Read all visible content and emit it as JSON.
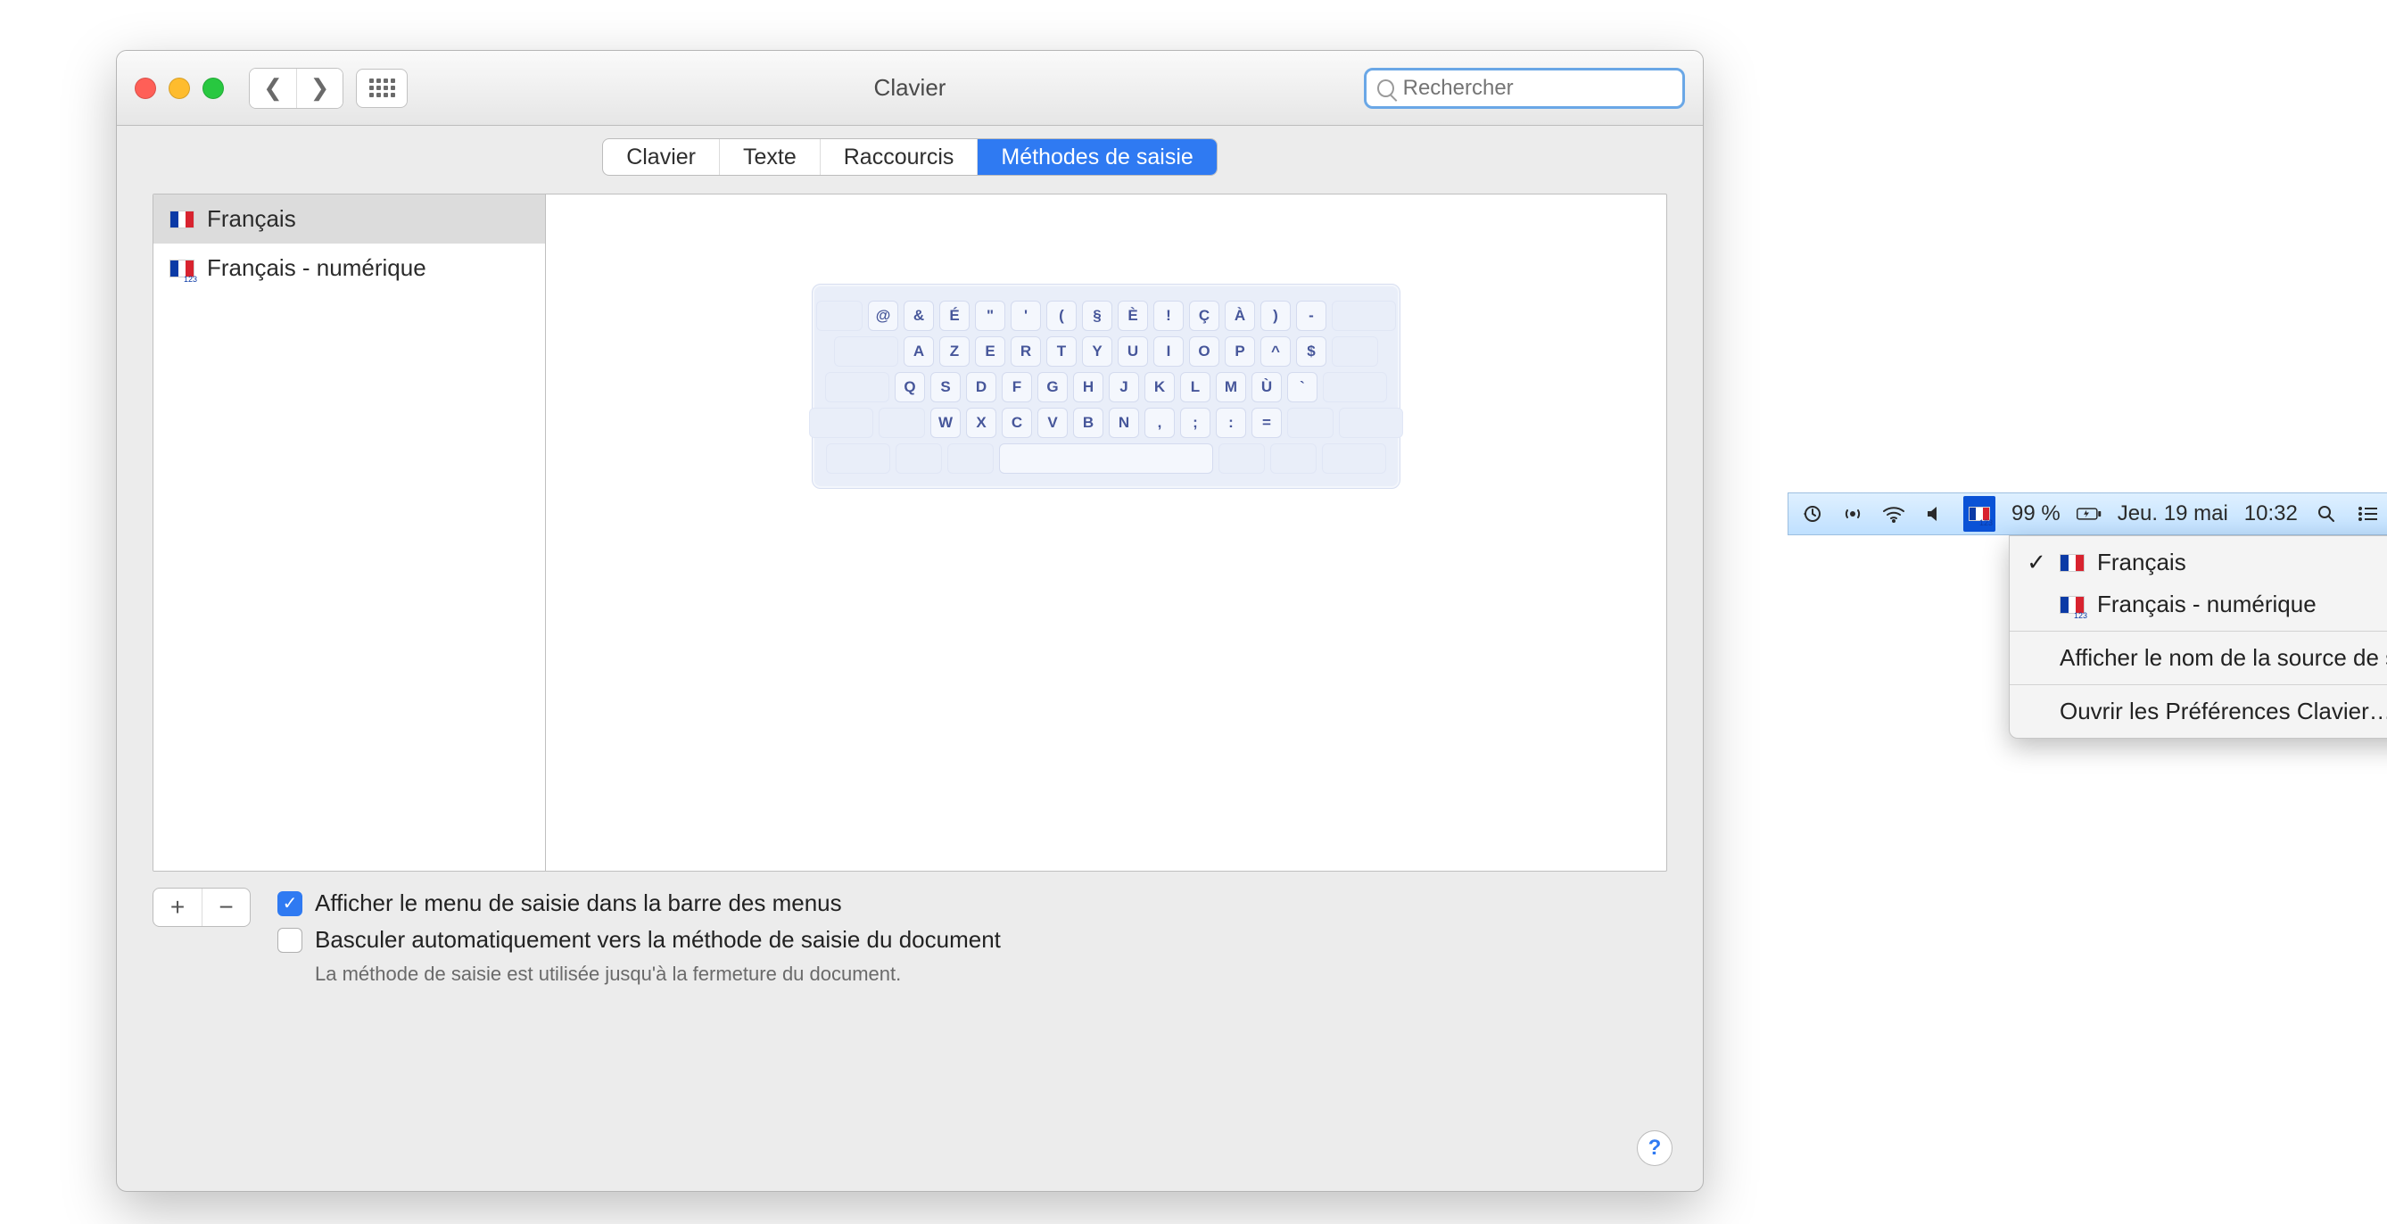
{
  "window": {
    "title": "Clavier",
    "search_placeholder": "Rechercher"
  },
  "tabs": [
    {
      "label": "Clavier"
    },
    {
      "label": "Texte"
    },
    {
      "label": "Raccourcis"
    },
    {
      "label": "Méthodes de saisie"
    }
  ],
  "sources": {
    "items": [
      {
        "label": "Français"
      },
      {
        "label": "Français - numérique"
      }
    ]
  },
  "keyboard_rows": [
    [
      "@",
      "&",
      "É",
      "\"",
      "'",
      "(",
      "§",
      "È",
      "!",
      "Ç",
      "À",
      ")",
      "-"
    ],
    [
      "A",
      "Z",
      "E",
      "R",
      "T",
      "Y",
      "U",
      "I",
      "O",
      "P",
      "^",
      "$"
    ],
    [
      "Q",
      "S",
      "D",
      "F",
      "G",
      "H",
      "J",
      "K",
      "L",
      "M",
      "Ù",
      "`"
    ],
    [
      "W",
      "X",
      "C",
      "V",
      "B",
      "N",
      ",",
      ";",
      ":",
      "="
    ]
  ],
  "checks": {
    "show_menu_label": "Afficher le menu de saisie dans la barre des menus",
    "auto_switch_label": "Basculer automatiquement vers la méthode de saisie du document",
    "auto_switch_hint": "La méthode de saisie est utilisée jusqu'à la fermeture du document."
  },
  "menubar": {
    "battery_text": "99 %",
    "date_text": "Jeu. 19 mai",
    "time_text": "10:32"
  },
  "dropdown": {
    "items": [
      {
        "label": "Français"
      },
      {
        "label": "Français - numérique"
      }
    ],
    "show_source_name": "Afficher le nom de la source de saisie",
    "open_prefs": "Ouvrir les Préférences Clavier…"
  }
}
